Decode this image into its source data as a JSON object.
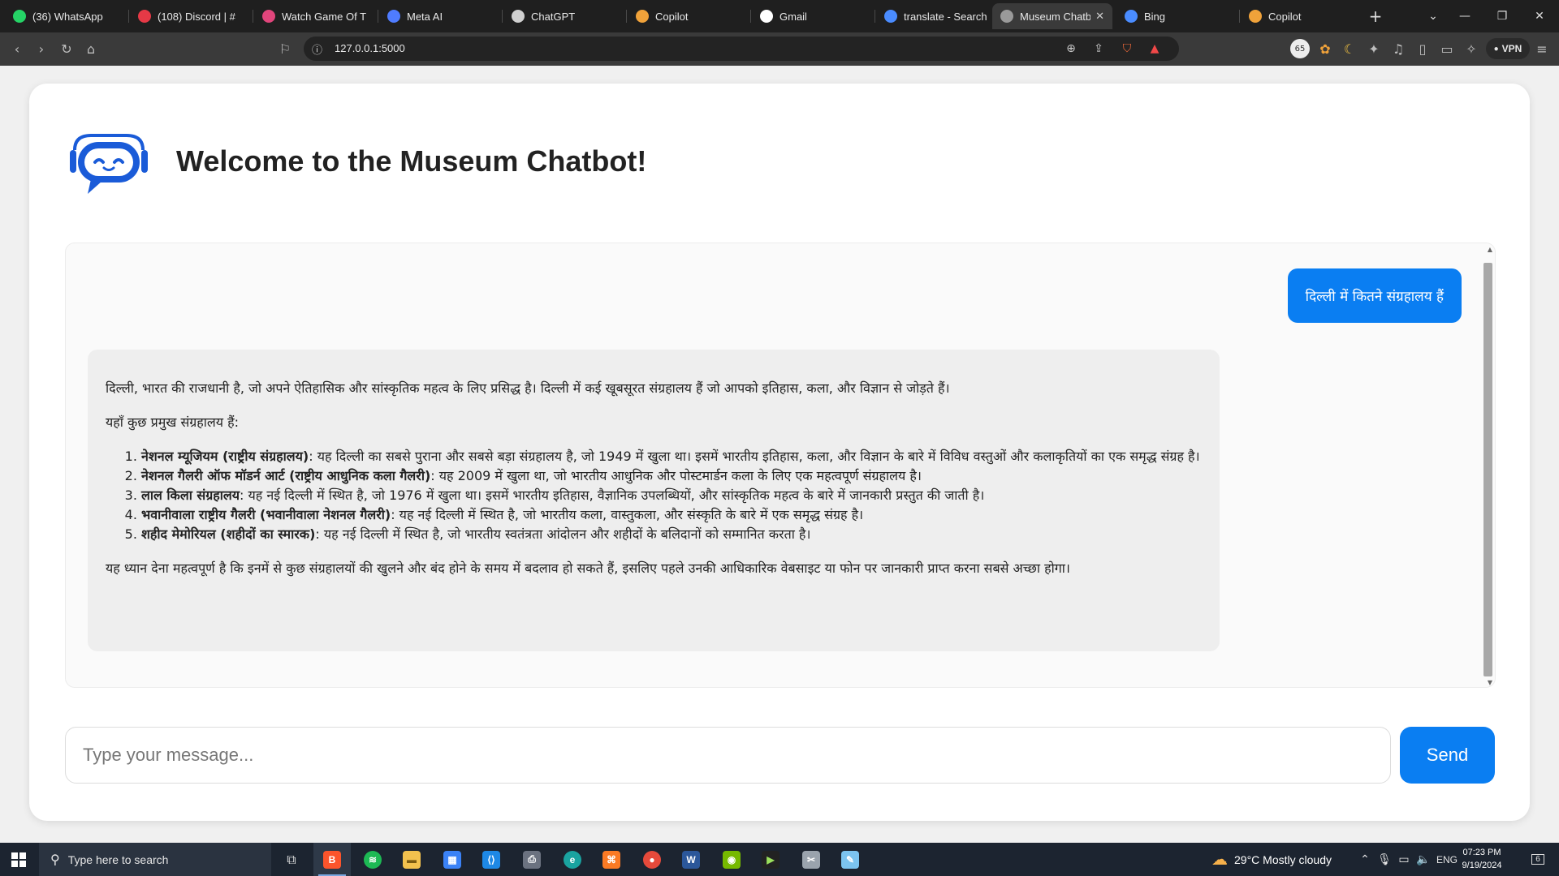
{
  "browser": {
    "tabs": [
      {
        "label": "(36) WhatsApp",
        "icon": "whatsapp-icon",
        "badge": "36",
        "color": "#25d366"
      },
      {
        "label": "(108) Discord | #",
        "icon": "discord-icon",
        "badge": "108",
        "color": "#e63946"
      },
      {
        "label": "Watch Game Of Thr",
        "icon": "video-icon",
        "color": "#e0457b"
      },
      {
        "label": "Meta AI",
        "icon": "meta-ai-icon",
        "color": "#4f7cff"
      },
      {
        "label": "ChatGPT",
        "icon": "chatgpt-icon",
        "color": "#cfcfcf"
      },
      {
        "label": "Copilot",
        "icon": "copilot-icon",
        "color": "#f0a23a"
      },
      {
        "label": "Gmail",
        "icon": "google-icon",
        "color": "#ffffff"
      },
      {
        "label": "translate - Search",
        "icon": "search-icon",
        "color": "#4a8cff"
      },
      {
        "label": "Museum Chatb",
        "icon": "globe-icon",
        "color": "#9a9a9a",
        "active": true
      },
      {
        "label": "Bing",
        "icon": "search-icon",
        "color": "#4a8cff"
      },
      {
        "label": "Copilot",
        "icon": "copilot-icon",
        "color": "#f0a23a"
      }
    ],
    "url": "127.0.0.1:5000",
    "vpn_label": "VPN",
    "profile_badge": "65"
  },
  "page": {
    "title": "Welcome to the Museum Chatbot!",
    "accent_color": "#0a7ef2"
  },
  "chat": {
    "user_message": "दिल्ली में कितने संग्रहालय हैं",
    "bot_intro": "दिल्ली, भारत की राजधानी है, जो अपने ऐतिहासिक और सांस्कृतिक महत्व के लिए प्रसिद्ध है। दिल्ली में कई खूबसूरत संग्रहालय हैं जो आपको इतिहास, कला, और विज्ञान से जोड़ते हैं।",
    "bot_list_intro": "यहाँ कुछ प्रमुख संग्रहालय हैं:",
    "museums": [
      {
        "name": "नेशनल म्यूजियम (राष्ट्रीय संग्रहालय)",
        "desc": ": यह दिल्ली का सबसे पुराना और सबसे बड़ा संग्रहालय है, जो 1949 में खुला था। इसमें भारतीय इतिहास, कला, और विज्ञान के बारे में विविध वस्तुओं और कलाकृतियों का एक समृद्ध संग्रह है।"
      },
      {
        "name": "नेशनल गैलरी ऑफ मॉडर्न आर्ट (राष्ट्रीय आधुनिक कला गैलरी)",
        "desc": ": यह 2009 में खुला था, जो भारतीय आधुनिक और पोस्टमार्डन कला के लिए एक महत्वपूर्ण संग्रहालय है।"
      },
      {
        "name": "लाल किला संग्रहालय",
        "desc": ": यह नई दिल्ली में स्थित है, जो 1976 में खुला था। इसमें भारतीय इतिहास, वैज्ञानिक उपलब्धियों, और सांस्कृतिक महत्व के बारे में जानकारी प्रस्तुत की जाती है।"
      },
      {
        "name": "भवानीवाला राष्ट्रीय गैलरी (भवानीवाला नेशनल गैलरी)",
        "desc": ": यह नई दिल्ली में स्थित है, जो भारतीय कला, वास्तुकला, और संस्कृति के बारे में एक समृद्ध संग्रह है।"
      },
      {
        "name": "शहीद मेमोरियल (शहीदों का स्मारक)",
        "desc": ": यह नई दिल्ली में स्थित है, जो भारतीय स्वतंत्रता आंदोलन और शहीदों के बलिदानों को सम्मानित करता है।"
      }
    ],
    "bot_outro": "यह ध्यान देना महत्वपूर्ण है कि इनमें से कुछ संग्रहालयों की खुलने और बंद होने के समय में बदलाव हो सकते हैं, इसलिए पहले उनकी आधिकारिक वेबसाइट या फोन पर जानकारी प्राप्त करना सबसे अच्छा होगा।",
    "input_placeholder": "Type your message...",
    "send_label": "Send"
  },
  "taskbar": {
    "search_placeholder": "Type here to search",
    "weather": "29°C  Mostly cloudy",
    "language": "ENG",
    "time": "07:23 PM",
    "date": "9/19/2024",
    "notification_count": "6"
  }
}
